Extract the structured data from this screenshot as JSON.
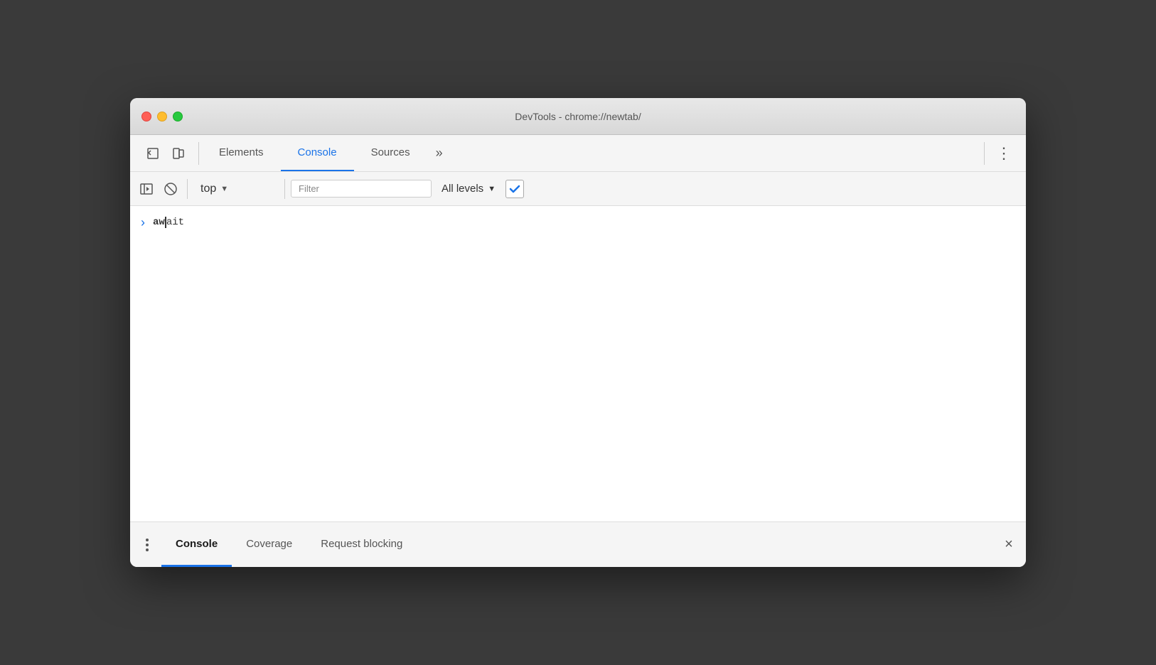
{
  "window": {
    "title": "DevTools - chrome://newtab/"
  },
  "toolbar": {
    "tabs": [
      {
        "id": "elements",
        "label": "Elements",
        "active": false
      },
      {
        "id": "console",
        "label": "Console",
        "active": true
      },
      {
        "id": "sources",
        "label": "Sources",
        "active": false
      }
    ],
    "more_label": "»",
    "menu_label": "⋮"
  },
  "console_toolbar": {
    "context_label": "top",
    "filter_placeholder": "Filter",
    "levels_label": "All levels"
  },
  "console": {
    "entry_chevron": "›",
    "entry_text_bold": "aw",
    "entry_text_light": "ait"
  },
  "bottom_panel": {
    "tabs": [
      {
        "id": "console",
        "label": "Console",
        "active": true
      },
      {
        "id": "coverage",
        "label": "Coverage",
        "active": false
      },
      {
        "id": "request-blocking",
        "label": "Request blocking",
        "active": false
      }
    ],
    "close_label": "×"
  }
}
